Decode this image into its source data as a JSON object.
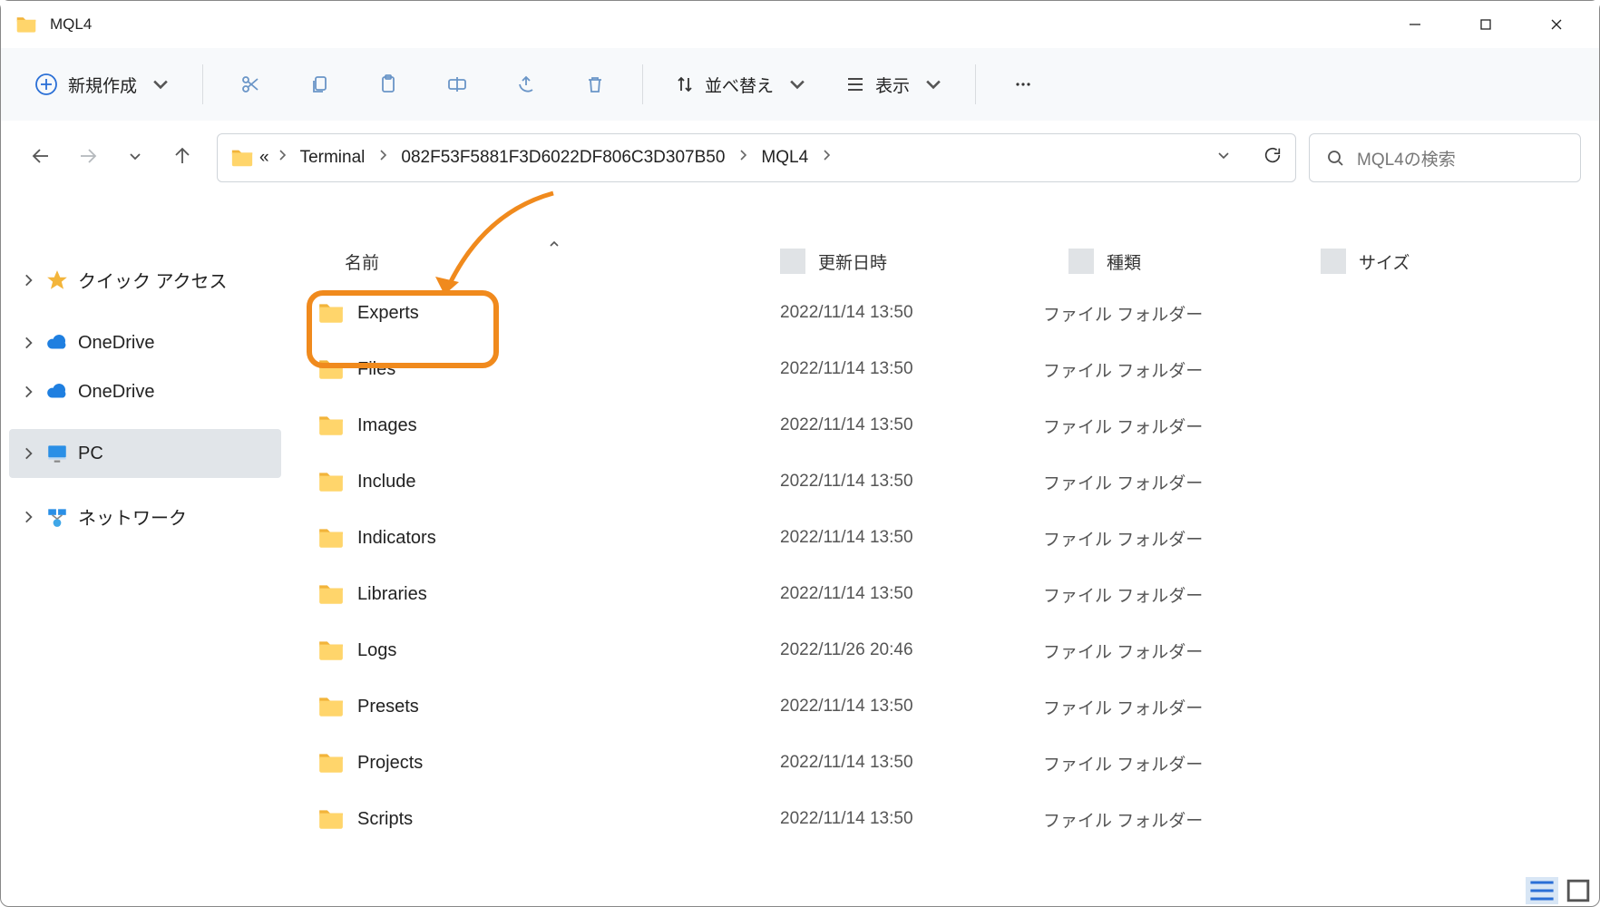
{
  "window": {
    "title": "MQL4"
  },
  "toolbar": {
    "new_label": "新規作成",
    "sort_label": "並べ替え",
    "view_label": "表示"
  },
  "breadcrumb": {
    "items": [
      "Terminal",
      "082F53F5881F3D6022DF806C3D307B50",
      "MQL4"
    ],
    "overflow": "«"
  },
  "search": {
    "placeholder": "MQL4の検索"
  },
  "sidebar": {
    "items": [
      {
        "label": "クイック アクセス",
        "icon": "star"
      },
      {
        "label": "OneDrive",
        "icon": "cloud"
      },
      {
        "label": "OneDrive",
        "icon": "cloud"
      },
      {
        "label": "PC",
        "icon": "monitor",
        "selected": true
      },
      {
        "label": "ネットワーク",
        "icon": "network"
      }
    ]
  },
  "columns": {
    "name": "名前",
    "date": "更新日時",
    "type": "種類",
    "size": "サイズ"
  },
  "files": [
    {
      "name": "Experts",
      "date": "2022/11/14 13:50",
      "type": "ファイル フォルダー",
      "highlighted": true
    },
    {
      "name": "Files",
      "date": "2022/11/14 13:50",
      "type": "ファイル フォルダー"
    },
    {
      "name": "Images",
      "date": "2022/11/14 13:50",
      "type": "ファイル フォルダー"
    },
    {
      "name": "Include",
      "date": "2022/11/14 13:50",
      "type": "ファイル フォルダー"
    },
    {
      "name": "Indicators",
      "date": "2022/11/14 13:50",
      "type": "ファイル フォルダー"
    },
    {
      "name": "Libraries",
      "date": "2022/11/14 13:50",
      "type": "ファイル フォルダー"
    },
    {
      "name": "Logs",
      "date": "2022/11/26 20:46",
      "type": "ファイル フォルダー"
    },
    {
      "name": "Presets",
      "date": "2022/11/14 13:50",
      "type": "ファイル フォルダー"
    },
    {
      "name": "Projects",
      "date": "2022/11/14 13:50",
      "type": "ファイル フォルダー"
    },
    {
      "name": "Scripts",
      "date": "2022/11/14 13:50",
      "type": "ファイル フォルダー"
    }
  ]
}
